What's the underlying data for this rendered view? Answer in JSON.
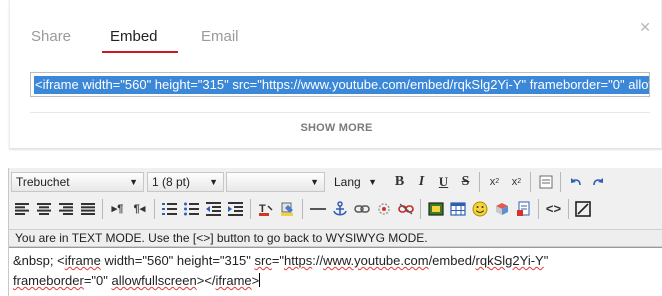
{
  "dialog": {
    "tabs": [
      "Share",
      "Embed",
      "Email"
    ],
    "active_tab": "Embed",
    "embed_code": "<iframe width=\"560\" height=\"315\" src=\"https://www.youtube.com/embed/rqkSlg2Yi-Y\" frameborder=\"0\" allowfullscreen></iframe>",
    "show_more_label": "SHOW MORE",
    "accent_color": "#cc181e",
    "selection_color": "#3b87d8"
  },
  "editor": {
    "font_family": "Trebuchet",
    "font_size": "1 (8 pt)",
    "format_value": "",
    "lang_label": "Lang",
    "bold_label": "B",
    "italic_label": "I",
    "underline_label": "U",
    "strike_label": "S",
    "subscript_label": "x",
    "subscript_sub": "2",
    "superscript_label": "x",
    "superscript_sup": "2",
    "source_toggle_label": "<>",
    "status_text": "You are in TEXT MODE. Use the [<>] button to go back to WYSIWYG MODE.",
    "content": {
      "nbsp": "&nbsp;",
      "part1": " <",
      "word_iframe1": "iframe",
      "part2": " width=\"560\" height=\"315\" ",
      "word_src": "src",
      "part3": "=\"",
      "word_url1": "https",
      "part4": "://",
      "word_url2": "www.youtube.com",
      "part5": "/embed/",
      "word_url3": "rqkSlg2Yi-Y",
      "part6": "\"",
      "line2_word1": "frameborder",
      "line2_part1": "=\"0\" ",
      "line2_word2": "allowfullscreen",
      "line2_part2": "></",
      "line2_word3": "iframe",
      "line2_part3": ">"
    }
  }
}
